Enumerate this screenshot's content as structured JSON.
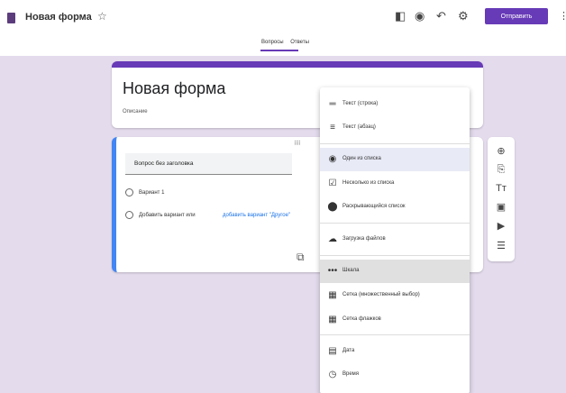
{
  "header": {
    "doc_title": "Новая форма",
    "send_label": "Отправить",
    "tabs": [
      "Вопросы",
      "Ответы"
    ]
  },
  "form": {
    "title": "Новая форма",
    "description": "Описание"
  },
  "question": {
    "title": "Вопрос без заголовка",
    "option1": "Вариант 1",
    "add_option": "Добавить вариант или",
    "add_other": "добавить вариант \"Другое\""
  },
  "menu": {
    "items": [
      "Текст (строка)",
      "Текст (абзац)",
      "Один из списка",
      "Несколько из списка",
      "Раскрывающийся список",
      "Загрузка файлов",
      "Шкала",
      "Сетка (множественный выбор)",
      "Сетка флажков",
      "Дата",
      "Время"
    ],
    "selected_index": 2
  },
  "colors": {
    "accent": "#673ab7",
    "canvas": "#e4dced",
    "active_border": "#4285f4"
  },
  "icons": [
    "customize-icon",
    "preview-icon",
    "undo-icon",
    "settings-icon"
  ]
}
